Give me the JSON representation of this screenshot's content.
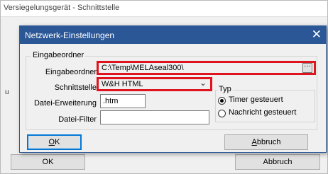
{
  "background_window": {
    "title": "Versiegelungsgerät - Schnittstelle",
    "left_fragment": "u",
    "ok_label": "OK",
    "cancel_label": "Abbruch"
  },
  "dialog": {
    "title": "Netzwerk-Einstellungen",
    "close_glyph": "✕",
    "group_title": "Eingabeordner",
    "input_folder": {
      "label": "Eingabeordner",
      "value": "C:\\Temp\\MELAseal300\\",
      "browse_label": "···"
    },
    "interface": {
      "label": "Schnittstelle",
      "value": "W&H HTML",
      "chevron": "⌄"
    },
    "file_extension": {
      "label": "Datei-Erweiterung",
      "value": ".htm"
    },
    "file_filter": {
      "label": "Datei-Filter",
      "value": ""
    },
    "type": {
      "title": "Typ",
      "options": [
        {
          "label": "Timer gesteuert",
          "checked": true
        },
        {
          "label": "Nachricht gesteuert",
          "checked": false
        }
      ]
    },
    "ok_accel": "O",
    "ok_rest": "K",
    "cancel_accel": "A",
    "cancel_rest": "bbruch"
  },
  "colors": {
    "titlebar": "#2b5797",
    "highlight": "#e0141e",
    "focus": "#0078d7"
  }
}
